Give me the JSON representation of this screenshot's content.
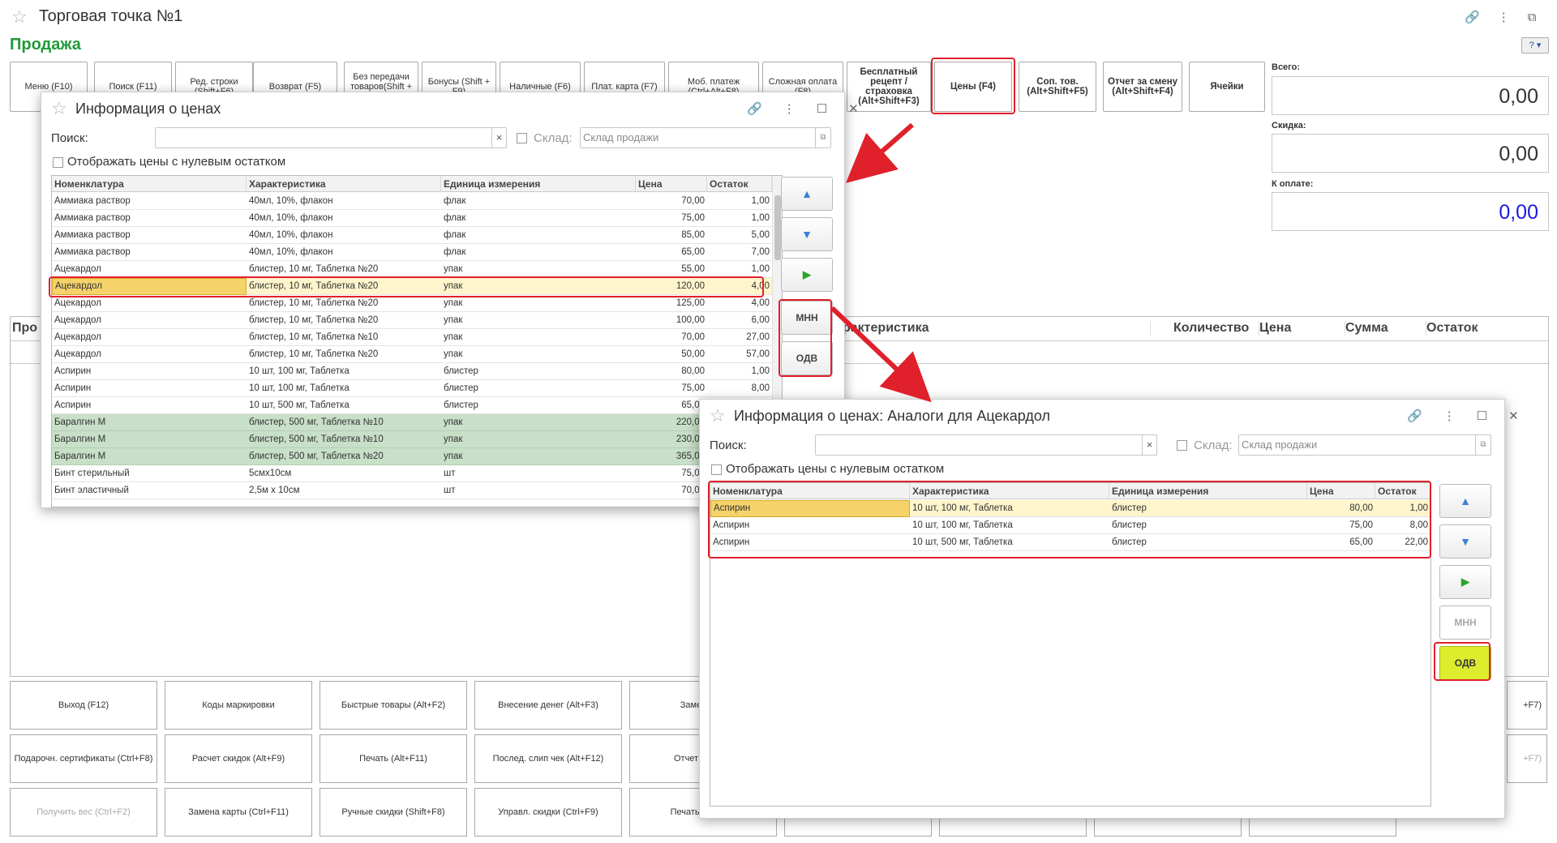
{
  "window": {
    "title": "Торговая точка №1",
    "subtitle": "Продажа",
    "help_label": "?"
  },
  "toolbar": [
    "Меню (F10)",
    "Поиск (F11)",
    "Ред. строки (Shift+F6)",
    "Возврат (F5)",
    "Без передачи товаров(Shift + F7)",
    "Бонусы (Shift + F9)",
    "Наличные (F6)",
    "Плат. карта (F7)",
    "Моб. платеж (Ctrl+Alt+F8)",
    "Сложная оплата (F8)",
    "Бесплатный рецепт / страховка (Alt+Shift+F3)",
    "Цены (F4)",
    "Соп. тов. (Alt+Shift+F5)",
    "Отчет за смену (Alt+Shift+F4)",
    "Ячейки"
  ],
  "totals": {
    "total_label": "Всего:",
    "total_value": "0,00",
    "discount_label": "Скидка:",
    "discount_value": "0,00",
    "pay_label": "К оплате:",
    "pay_value": "0,00",
    "pay_color": "#1a1adf"
  },
  "main_table": {
    "columns": [
      "Про",
      "рактеристика",
      "Количество",
      "Цена",
      "Сумма",
      "Остаток"
    ]
  },
  "bottom_buttons": [
    [
      "Выход (F12)",
      "Коды маркировки",
      "Быстрые товары (Alt+F2)",
      "Внесение денег (Alt+F3)",
      "Заменить г"
    ],
    [
      "Подарочн. сертификаты (Ctrl+F8)",
      "Расчет скидок (Alt+F9)",
      "Печать (Alt+F11)",
      "Послед. слип чек (Alt+F12)",
      "Отчет без гаш"
    ],
    [
      "Получить вес (Ctrl+F2)",
      "Замена карты (Ctrl+F11)",
      "Ручные скидки (Shift+F8)",
      "Управл. скидки (Ctrl+F9)",
      "Печать пробито"
    ]
  ],
  "bottom_right_fragments": [
    "+F7)",
    "+F7)"
  ],
  "dialog1": {
    "title": "Информация о ценах",
    "search_label": "Поиск:",
    "search_value": "",
    "clear_label": "×",
    "warehouse_label": "Склад:",
    "warehouse_placeholder": "Склад продажи",
    "zero_label": "Отображать цены с нулевым остатком",
    "columns": [
      "Номенклатура",
      "Характеристика",
      "Единица измерения",
      "Цена",
      "Остаток"
    ],
    "rows": [
      [
        "Аммиака раствор",
        "40мл, 10%, флакон",
        "флак",
        "70,00",
        "1,00"
      ],
      [
        "Аммиака раствор",
        "40мл, 10%, флакон",
        "флак",
        "75,00",
        "1,00"
      ],
      [
        "Аммиака раствор",
        "40мл, 10%, флакон",
        "флак",
        "85,00",
        "5,00"
      ],
      [
        "Аммиака раствор",
        "40мл, 10%, флакон",
        "флак",
        "65,00",
        "7,00"
      ],
      [
        "Ацекардол",
        "блистер, 10 мг, Таблетка №20",
        "упак",
        "55,00",
        "1,00"
      ],
      [
        "Ацекардол",
        "блистер, 10 мг, Таблетка №20",
        "упак",
        "120,00",
        "4,00"
      ],
      [
        "Ацекардол",
        "блистер, 10 мг, Таблетка №20",
        "упак",
        "125,00",
        "4,00"
      ],
      [
        "Ацекардол",
        "блистер, 10 мг, Таблетка №20",
        "упак",
        "100,00",
        "6,00"
      ],
      [
        "Ацекардол",
        "блистер, 10 мг, Таблетка №10",
        "упак",
        "70,00",
        "27,00"
      ],
      [
        "Ацекардол",
        "блистер, 10 мг, Таблетка №20",
        "упак",
        "50,00",
        "57,00"
      ],
      [
        "Аспирин",
        "10 шт, 100 мг, Таблетка",
        "блистер",
        "80,00",
        "1,00"
      ],
      [
        "Аспирин",
        "10 шт, 100 мг, Таблетка",
        "блистер",
        "75,00",
        "8,00"
      ],
      [
        "Аспирин",
        "10 шт, 500 мг, Таблетка",
        "блистер",
        "65,00",
        "22,00"
      ],
      [
        "Баралгин М",
        "блистер, 500 мг, Таблетка №10",
        "упак",
        "220,00",
        ""
      ],
      [
        "Баралгин М",
        "блистер, 500 мг, Таблетка №10",
        "упак",
        "230,00",
        ""
      ],
      [
        "Баралгин М",
        "блистер, 500 мг, Таблетка №20",
        "упак",
        "365,00",
        ""
      ],
      [
        "Бинт стерильный",
        "5смх10см",
        "шт",
        "75,00",
        ""
      ],
      [
        "Бинт эластичный",
        "2,5м х 10см",
        "шт",
        "70,00",
        ""
      ]
    ],
    "selected_row": 5,
    "green_rows": [
      13,
      14,
      15
    ],
    "side_buttons": [
      "▲",
      "▼",
      "▶",
      "МНН",
      "ОДВ"
    ]
  },
  "dialog2": {
    "title": "Информация о ценах: Аналоги для Ацекардол",
    "search_label": "Поиск:",
    "search_value": "",
    "clear_label": "×",
    "warehouse_label": "Склад:",
    "warehouse_placeholder": "Склад продажи",
    "zero_label": "Отображать цены с нулевым остатком",
    "columns": [
      "Номенклатура",
      "Характеристика",
      "Единица измерения",
      "Цена",
      "Остаток"
    ],
    "rows": [
      [
        "Аспирин",
        "10 шт, 100 мг, Таблетка",
        "блистер",
        "80,00",
        "1,00"
      ],
      [
        "Аспирин",
        "10 шт, 100 мг, Таблетка",
        "блистер",
        "75,00",
        "8,00"
      ],
      [
        "Аспирин",
        "10 шт, 500 мг, Таблетка",
        "блистер",
        "65,00",
        "22,00"
      ]
    ],
    "selected_row": 0,
    "side_buttons": [
      "▲",
      "▼",
      "▶",
      "МНН",
      "ОДВ"
    ]
  },
  "colors": {
    "accent_green": "#1f9a3a",
    "highlight_red": "#e0202a",
    "odv_active": "#dded2e"
  }
}
